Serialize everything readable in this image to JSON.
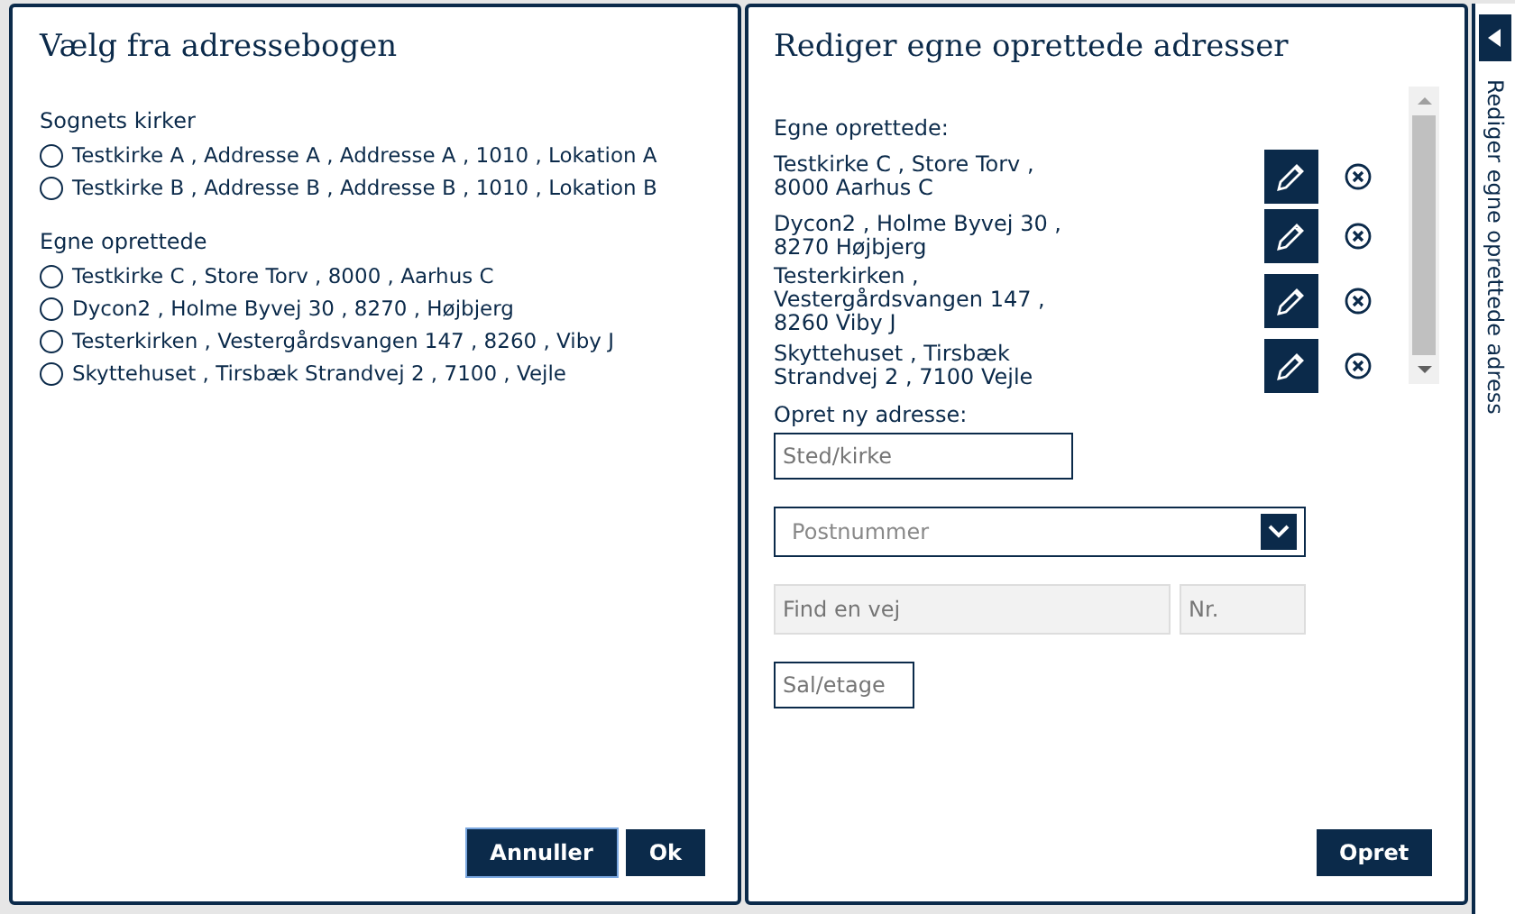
{
  "left_dialog": {
    "title": "Vælg fra adressebogen",
    "groups": [
      {
        "heading": "Sognets kirker",
        "options": [
          {
            "label": "Testkirke A , Addresse A , Addresse A , 1010 , Lokation A",
            "selected": false
          },
          {
            "label": "Testkirke B , Addresse B , Addresse B , 1010 , Lokation B",
            "selected": false
          }
        ]
      },
      {
        "heading": "Egne oprettede",
        "options": [
          {
            "label": "Testkirke C , Store Torv , 8000 , Aarhus C",
            "selected": false
          },
          {
            "label": "Dycon2 , Holme Byvej 30 , 8270 , Højbjerg",
            "selected": false
          },
          {
            "label": "Testerkirken , Vestergårdsvangen 147 , 8260 , Viby J",
            "selected": false
          },
          {
            "label": "Skyttehuset , Tirsbæk Strandvej 2 , 7100 , Vejle",
            "selected": false
          }
        ]
      }
    ],
    "buttons": [
      {
        "label": "Annuller",
        "focused": true
      },
      {
        "label": "Ok",
        "focused": false
      }
    ]
  },
  "right_dialog": {
    "title": "Rediger egne oprettede adresser",
    "list_heading": "Egne oprettede:",
    "addresses": [
      {
        "lines": [
          "Testkirke C , Store Torv ,",
          "8000 Aarhus C"
        ]
      },
      {
        "lines": [
          "Dycon2 , Holme Byvej 30 ,",
          "8270 Højbjerg"
        ]
      },
      {
        "lines": [
          "Testerkirken ,",
          "Vestergårdsvangen 147 ,",
          "8260 Viby J"
        ]
      },
      {
        "lines": [
          "Skyttehuset , Tirsbæk",
          "Strandvej 2 , 7100 Vejle"
        ]
      }
    ],
    "form_heading": "Opret ny adresse:",
    "place": {
      "placeholder": "Sted/kirke"
    },
    "postcode": {
      "placeholder": "Postnummer"
    },
    "street": {
      "placeholder": "Find en vej",
      "disabled": true
    },
    "number": {
      "placeholder": "Nr.",
      "disabled": true
    },
    "floor": {
      "placeholder": "Sal/etage"
    },
    "submit": "Opret"
  },
  "side_panel": {
    "label": "Rediger egne oprettede adress"
  }
}
